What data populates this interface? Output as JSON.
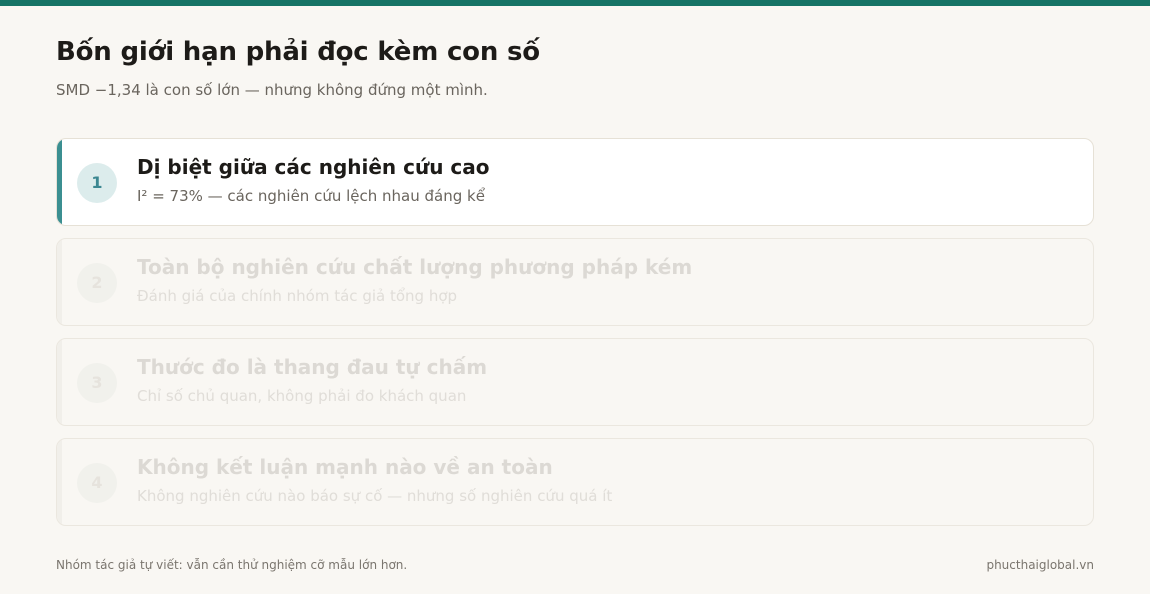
{
  "header": {
    "title": "Bốn giới hạn phải đọc kèm con số",
    "subtitle": "SMD −1,34 là con số lớn — nhưng không đứng một mình."
  },
  "limitations": [
    {
      "number": "1",
      "title": "Dị biệt giữa các nghiên cứu cao",
      "description": "I² = 73% — các nghiên cứu lệch nhau đáng kể",
      "active": true
    },
    {
      "number": "2",
      "title": "Toàn bộ nghiên cứu chất lượng phương pháp kém",
      "description": "Đánh giá của chính nhóm tác giả tổng hợp",
      "active": false
    },
    {
      "number": "3",
      "title": "Thước đo là thang đau tự chấm",
      "description": "Chỉ số chủ quan, không phải đo khách quan",
      "active": false
    },
    {
      "number": "4",
      "title": "Không kết luận mạnh nào về an toàn",
      "description": "Không nghiên cứu nào báo sự cố — nhưng số nghiên cứu quá ít",
      "active": false
    }
  ],
  "footer": {
    "note": "Nhóm tác giả tự viết: vẫn cần thử nghiệm cỡ mẫu lớn hơn.",
    "brand": "phucthaiglobal.vn"
  },
  "colors": {
    "accent": "#167466",
    "active_bar": "#3b8f91"
  }
}
